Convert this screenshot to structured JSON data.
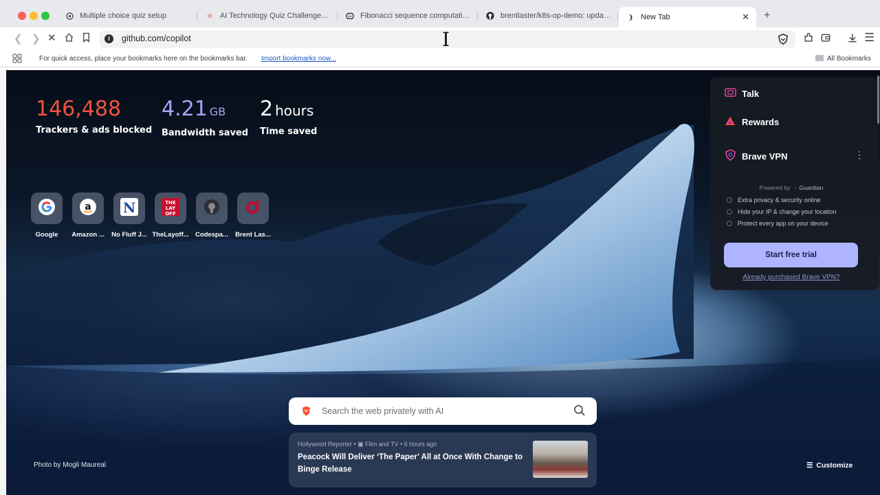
{
  "tabs": [
    {
      "title": "Multiple choice quiz setup",
      "icon": "chatgpt-icon"
    },
    {
      "title": "AI Technology Quiz Challenge - Cl",
      "icon": "claude-icon"
    },
    {
      "title": "Fibonacci sequence computation ii",
      "icon": "copilot-icon"
    },
    {
      "title": "brentlaster/k8s-op-demo: updated",
      "icon": "github-icon"
    },
    {
      "title": "New Tab",
      "icon": "loading-icon",
      "active": true
    }
  ],
  "address_bar": {
    "url": "github.com/copilot"
  },
  "bookmarks_bar": {
    "prompt": "For quick access, place your bookmarks here on the bookmarks bar.",
    "import_link": "Import bookmarks now...",
    "all_bookmarks": "All Bookmarks"
  },
  "stats": {
    "trackers": {
      "value": "146,488",
      "label": "Trackers & ads blocked",
      "color": "#f0533f"
    },
    "bandwidth": {
      "value": "4.21",
      "unit": "GB",
      "label": "Bandwidth saved",
      "color": "#a7a6f5"
    },
    "time": {
      "value": "2",
      "unit": "hours",
      "label": "Time saved",
      "color": "#ffffff"
    }
  },
  "top_sites": [
    {
      "label": "Google"
    },
    {
      "label": "Amazon ..."
    },
    {
      "label": "No Fluff J..."
    },
    {
      "label": "TheLayoff..."
    },
    {
      "label": "Codespa..."
    },
    {
      "label": "Brent Las..."
    }
  ],
  "panel": {
    "talk": "Talk",
    "rewards": "Rewards",
    "vpn": "Brave VPN",
    "powered_by": "Powered by",
    "guardian": "Guardian",
    "features": [
      "Extra privacy & security online",
      "Hide your IP & change your location",
      "Protect every app on your device"
    ],
    "trial_button": "Start free trial",
    "purchased_link": "Already purchased Brave VPN?"
  },
  "search": {
    "placeholder": "Search the web privately with AI"
  },
  "news": {
    "source": "Hollywood Reporter",
    "category": "Film and TV",
    "age": "6 hours ago",
    "title": "Peacock Will Deliver ‘The Paper’ All at Once With Change to Binge Release"
  },
  "photo_credit": "Photo by Mogli Maureal",
  "customize": "Customize"
}
